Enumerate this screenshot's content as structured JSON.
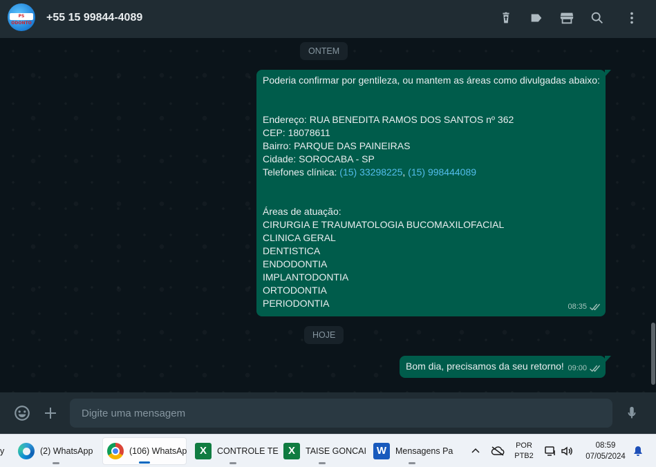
{
  "header": {
    "contact_name": "+55 15 99844-4089",
    "avatar_text": "PS ODONTO",
    "icons": [
      "trash-icon",
      "label-icon",
      "store-icon",
      "search-icon",
      "menu-dots-icon"
    ]
  },
  "chat": {
    "date_yesterday": "ONTEM",
    "date_today": "HOJE",
    "message1": {
      "lines": [
        "Poderia confirmar por gentileza, ou mantem as áreas como divulgadas abaixo:",
        "",
        "",
        "Endereço: RUA BENEDITA RAMOS DOS SANTOS nº 362",
        "CEP: 18078611",
        "Bairro: PARQUE DAS PAINEIRAS",
        "Cidade: SOROCABA - SP"
      ],
      "phones_prefix": "Telefones clínica: ",
      "phone1": "(15) 33298225",
      "phone_sep": ", ",
      "phone2": "(15) 998444089",
      "lines_after": [
        "",
        "",
        "Áreas de atuação:",
        "CIRURGIA E TRAUMATOLOGIA BUCOMAXILOFACIAL",
        "CLINICA GERAL",
        "DENTISTICA",
        "ENDODONTIA",
        "IMPLANTODONTIA",
        "ORTODONTIA",
        "PERIODONTIA"
      ],
      "time": "08:35"
    },
    "message2": {
      "text": "Bom dia, precisamos da seu retorno!",
      "time": "09:00"
    }
  },
  "compose": {
    "placeholder": "Digite uma mensagem",
    "icons": [
      "emoji-icon",
      "plus-icon",
      "microphone-icon"
    ]
  },
  "taskbar": {
    "partial_label": "y",
    "items": [
      {
        "label": "(2) WhatsApp",
        "icon": "edge-icon"
      },
      {
        "label": "(106) WhatsAp",
        "icon": "chrome-icon"
      },
      {
        "label": "CONTROLE TE",
        "icon": "excel-icon"
      },
      {
        "label": "TAISE GONCAI",
        "icon": "excel-icon"
      },
      {
        "label": "Mensagens Pa",
        "icon": "word-icon"
      }
    ],
    "lang_top": "POR",
    "lang_bottom": "PTB2",
    "time": "08:59",
    "date": "07/05/2024",
    "colors": {
      "accent": "#0067c0",
      "excel": "#107c41",
      "word": "#185abd"
    }
  },
  "colors": {
    "outgoing_bubble": "#005c4b",
    "header_bg": "#202c33",
    "chat_bg": "#0b141a",
    "link": "#53bdeb"
  }
}
